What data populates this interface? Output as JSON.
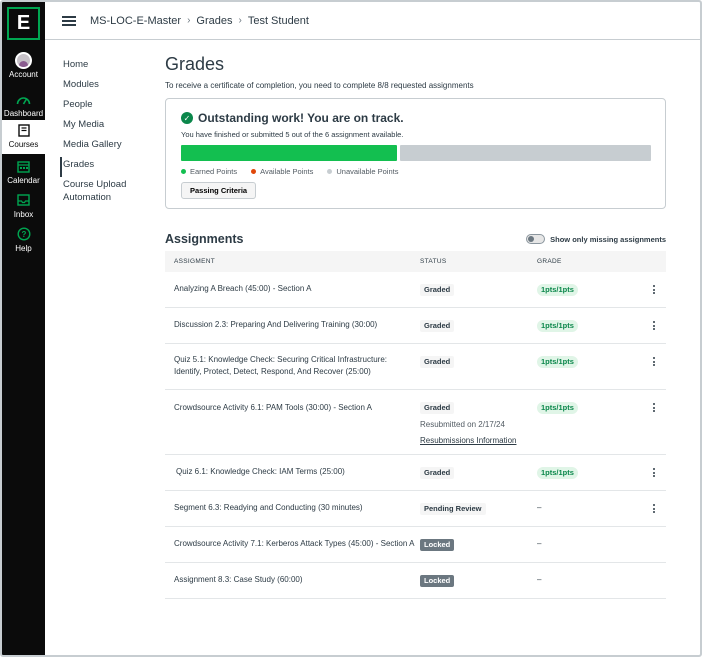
{
  "global_nav": {
    "logo_letter": "E",
    "items": [
      {
        "label": "Account",
        "icon": "account-avatar"
      },
      {
        "label": "Dashboard",
        "icon": "dashboard-gauge-icon"
      },
      {
        "label": "Courses",
        "icon": "book-icon",
        "active": true
      },
      {
        "label": "Calendar",
        "icon": "calendar-icon"
      },
      {
        "label": "Inbox",
        "icon": "inbox-icon"
      },
      {
        "label": "Help",
        "icon": "help-icon"
      }
    ]
  },
  "breadcrumb": [
    "MS-LOC-E-Master",
    "Grades",
    "Test Student"
  ],
  "course_nav": [
    {
      "label": "Home"
    },
    {
      "label": "Modules"
    },
    {
      "label": "People"
    },
    {
      "label": "My Media"
    },
    {
      "label": "Media Gallery"
    },
    {
      "label": "Grades",
      "active": true
    },
    {
      "label": "Course Upload Automation"
    }
  ],
  "page": {
    "title": "Grades",
    "subtitle": "To receive a certificate of completion, you need to complete 8/8 requested assignments"
  },
  "status_card": {
    "heading": "Outstanding work! You are on track.",
    "message": "You have finished or submitted 5 out of the 6 assignment available.",
    "progress_fraction": 0.46,
    "legend": [
      {
        "label": "Earned Points",
        "color": "#13bf50"
      },
      {
        "label": "Available Points",
        "color": "#e0470a"
      },
      {
        "label": "Unavailable Points",
        "color": "#c7cdd1"
      }
    ],
    "criteria_button": "Passing Criteria"
  },
  "assignments": {
    "title": "Assignments",
    "toggle_label": "Show only missing assignments",
    "columns": [
      "ASSIGMENT",
      "STATUS",
      "GRADE"
    ],
    "rows": [
      {
        "name": "Analyzing A Breach (45:00) - Section A",
        "status": "Graded",
        "grade": "1pts/1pts"
      },
      {
        "name": "Discussion 2.3: Preparing And Delivering Training (30:00)",
        "status": "Graded",
        "grade": "1pts/1pts"
      },
      {
        "name": "Quiz 5.1: Knowledge Check: Securing Critical Infrastructure: Identify, Protect, Detect, Respond, And Recover (25:00)",
        "status": "Graded",
        "grade": "1pts/1pts"
      },
      {
        "name": "Crowdsource Activity 6.1: PAM Tools (30:00) - Section A",
        "status": "Graded",
        "grade": "1pts/1pts",
        "resubmitted": "Resubmitted on 2/17/24",
        "resub_link": "Resubmissions Information"
      },
      {
        "name": "Quiz 6.1: Knowledge Check: IAM Terms (25:00)",
        "status": "Graded",
        "grade": "1pts/1pts"
      },
      {
        "name": "Segment 6.3: Readying and Conducting (30 minutes)",
        "status": "Pending Review",
        "grade": "–"
      },
      {
        "name": "Crowdsource Activity 7.1: Kerberos Attack Types (45:00) - Section A",
        "status": "Locked",
        "grade": "–"
      },
      {
        "name": "Assignment 8.3: Case Study (60:00)",
        "status": "Locked",
        "grade": "–"
      }
    ]
  }
}
